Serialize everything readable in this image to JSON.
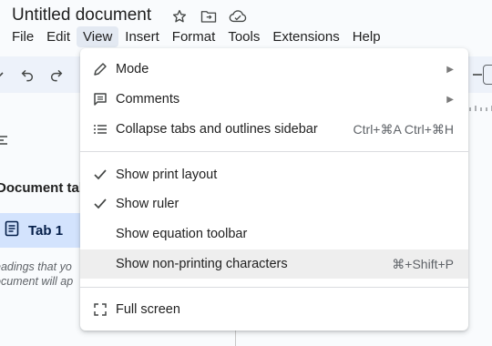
{
  "document": {
    "title": "Untitled document"
  },
  "menubar": {
    "items": [
      "File",
      "Edit",
      "View",
      "Insert",
      "Format",
      "Tools",
      "Extensions",
      "Help"
    ],
    "active": "View"
  },
  "sidebar": {
    "section_label": "Document tab",
    "tab_label": "Tab 1",
    "hint_line1": "eadings that yo",
    "hint_line2": "ocument will ap"
  },
  "view_menu": {
    "mode": {
      "label": "Mode",
      "icon": "pencil-icon"
    },
    "comments": {
      "label": "Comments",
      "icon": "comment-icon"
    },
    "collapse_tabs": {
      "label": "Collapse tabs and outlines sidebar",
      "shortcut": "Ctrl+⌘A Ctrl+⌘H",
      "icon": "list-icon"
    },
    "print_layout": {
      "label": "Show print layout",
      "checked": true
    },
    "ruler": {
      "label": "Show ruler",
      "checked": true
    },
    "equation_toolbar": {
      "label": "Show equation toolbar",
      "checked": false
    },
    "non_printing": {
      "label": "Show non-printing characters",
      "shortcut": "⌘+Shift+P",
      "checked": false
    },
    "full_screen": {
      "label": "Full screen",
      "icon": "fullscreen-icon"
    }
  },
  "colors": {
    "menu_active_bg": "#e3e9f2",
    "tab_active_bg": "#d3e3fd",
    "hover_row_bg": "#eeeeee"
  }
}
